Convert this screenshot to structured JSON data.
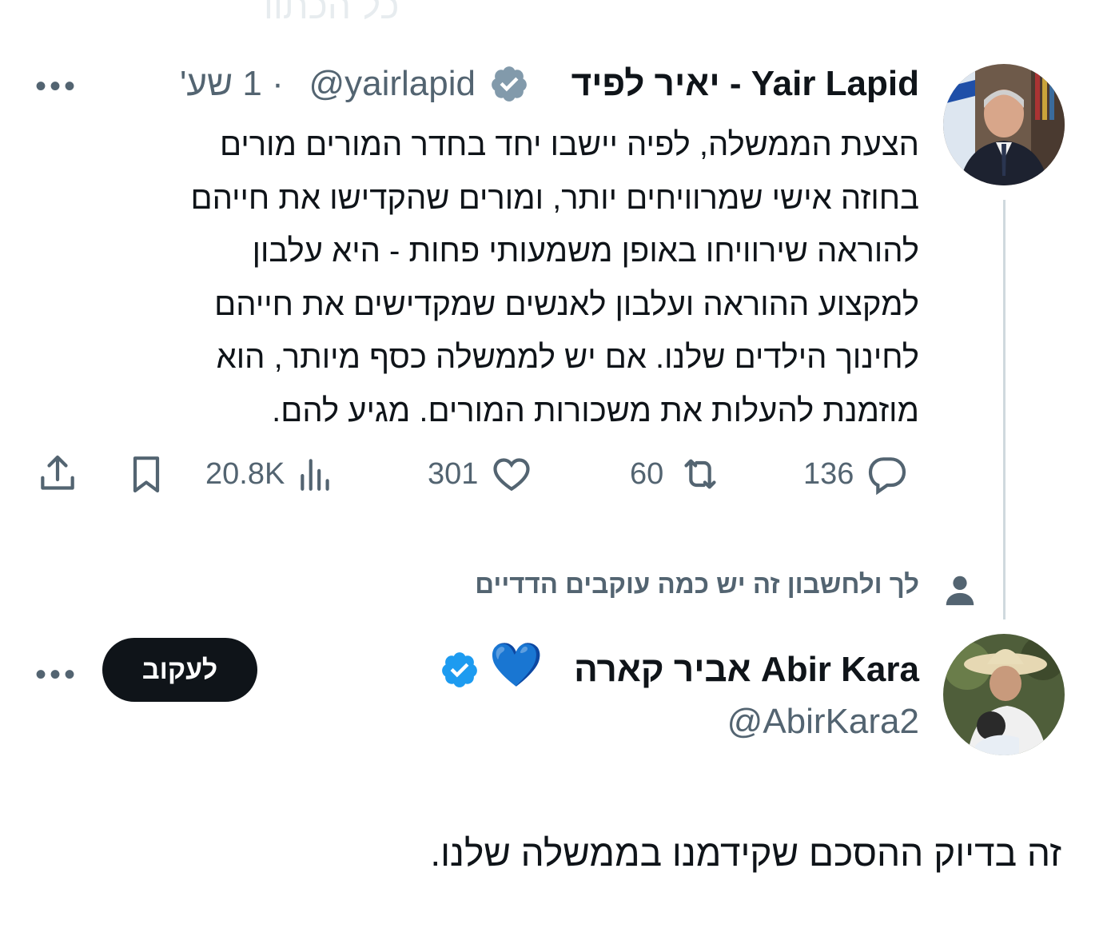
{
  "top_faded_text": "כל הכתוו",
  "tweet": {
    "author_name": "יאיר לפיד - Yair Lapid",
    "handle": "@yairlapid",
    "time": "· 1 שע'",
    "more_icon": "more-horizontal-icon",
    "lines": [
      "הצעת הממשלה, לפיה יישבו יחד בחדר המורים מורים",
      "בחוזה אישי שמרוויחים יותר, ומורים שהקדישו את חייהם",
      "להוראה שירוויחו באופן משמעותי פחות - היא עלבון",
      "למקצוע ההוראה ועלבון לאנשים שמקדישים את חייהם",
      "לחינוך הילדים שלנו. אם יש לממשלה כסף מיותר, הוא",
      "מוזמנת להעלות את משכורות המורים. מגיע להם."
    ],
    "stats": {
      "replies": "136",
      "reposts": "60",
      "likes": "301",
      "views": "20.8K"
    }
  },
  "social_context": "לך ולחשבון זה יש כמה עוקבים הדדיים",
  "reply": {
    "author_name": "אביר קארה Abir Kara",
    "emoji": "💙",
    "handle": "@AbirKara2",
    "follow_label": "לעקוב",
    "text": "זה בדיוק ההסכם שקידמנו בממשלה שלנו."
  },
  "colors": {
    "text": "#0f1419",
    "muted": "#536471",
    "verified_gray": "#829aab",
    "verified_blue": "#1d9bf0",
    "heart_blue": "#1d6ff2",
    "thread_line": "#cfd9de"
  }
}
